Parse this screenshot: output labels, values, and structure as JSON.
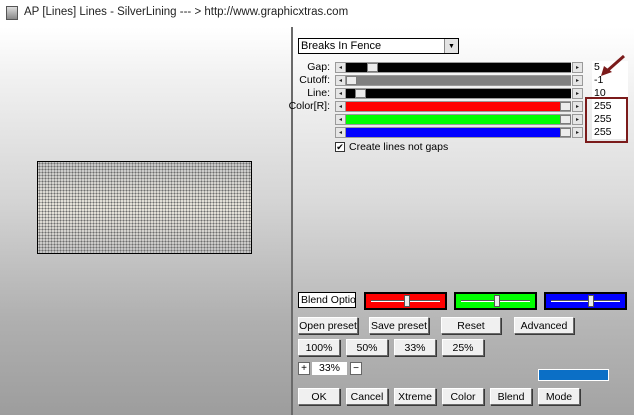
{
  "window": {
    "title": "AP [Lines]  Lines - SilverLining    --- > http://www.graphicxtras.com"
  },
  "preset_dropdown": {
    "value": "Breaks In Fence"
  },
  "sliders": [
    {
      "label": "Gap:",
      "value": "5",
      "fill_color": "#000000",
      "fraction": 0.1
    },
    {
      "label": "Cutoff:",
      "value": "-1",
      "fill_color": "#808080",
      "fraction": 0.0
    },
    {
      "label": "Line:",
      "value": "10",
      "fill_color": "#000000",
      "fraction": 0.04
    },
    {
      "label": "Color[R]:",
      "value": "255",
      "fill_color": "#ff0000",
      "fraction": 1.0
    },
    {
      "label": "",
      "value": "255",
      "fill_color": "#00ff00",
      "fraction": 1.0
    },
    {
      "label": "",
      "value": "255",
      "fill_color": "#0000ff",
      "fraction": 1.0
    }
  ],
  "checkbox": {
    "label": "Create lines not gaps",
    "checked_glyph": "✔"
  },
  "blend_select": {
    "value": "Blend Options"
  },
  "color_sliders": [
    {
      "color": "#ff0000",
      "fraction": 0.53
    },
    {
      "color": "#00ff00",
      "fraction": 0.53
    },
    {
      "color": "#0000ff",
      "fraction": 0.58
    }
  ],
  "preset_buttons": [
    "Open preset",
    "Save preset",
    "Reset",
    "Advanced"
  ],
  "zoom_buttons": [
    "100%",
    "50%",
    "33%",
    "25%"
  ],
  "zoom_control": {
    "plus": "+",
    "value": "33%",
    "minus": "−"
  },
  "action_buttons": [
    "OK",
    "Cancel",
    "Xtreme",
    "Color",
    "Blend",
    "Mode"
  ],
  "accent_color": "#0b6fc6",
  "annotation_color": "#7b1b1b",
  "icons": {
    "arrow_left": "◂",
    "arrow_right": "▸",
    "dropdown_arrow": "▼"
  }
}
